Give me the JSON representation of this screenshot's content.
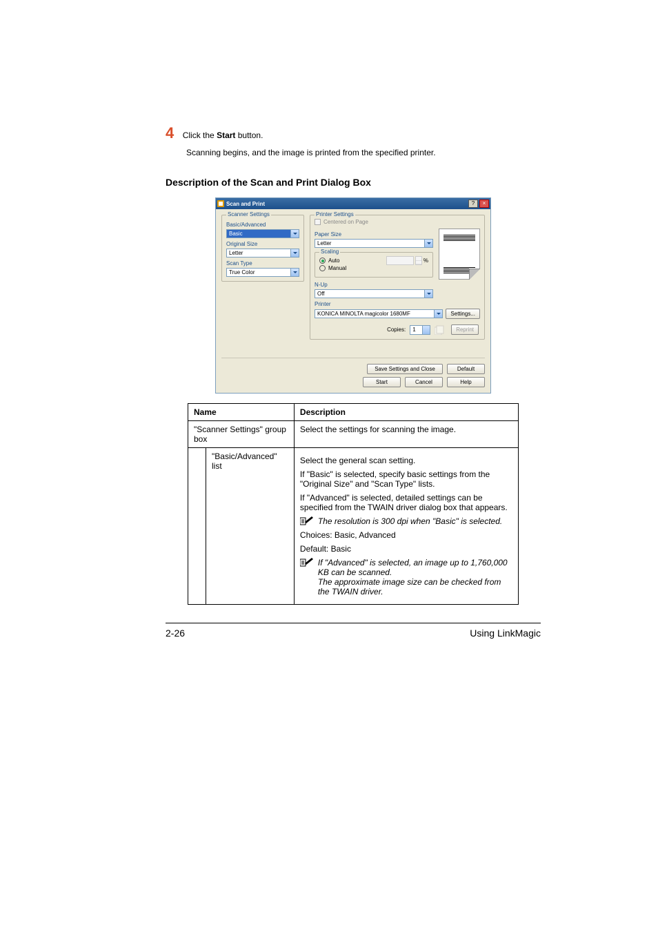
{
  "step": {
    "num": "4",
    "line": "Click the ",
    "bold": "Start",
    "line_after": " button.",
    "sub": "Scanning begins, and the image is printed from the specified printer."
  },
  "heading": "Description of the Scan and Print Dialog Box",
  "dialog": {
    "title": "Scan and Print",
    "help": "?",
    "close": "×",
    "scanner": {
      "legend": "Scanner Settings",
      "basic_label": "Basic/Advanced",
      "basic_value": "Basic",
      "orig_label": "Original Size",
      "orig_value": "Letter",
      "scan_label": "Scan Type",
      "scan_value": "True Color"
    },
    "printer": {
      "legend": "Printer Settings",
      "centered": "Centered on Page",
      "paper_label": "Paper Size",
      "paper_value": "Letter",
      "scaling_legend": "Scaling",
      "auto": "Auto",
      "manual": "Manual",
      "pct": "%",
      "nup_label": "N-Up",
      "nup_value": "Off",
      "printer_label": "Printer",
      "printer_value": "KONICA MINOLTA magicolor 1680MF",
      "settings_btn": "Settings...",
      "copies_label": "Copies:",
      "copies_value": "1",
      "reprint_btn": "Reprint"
    },
    "footer": {
      "save": "Save Settings and Close",
      "default": "Default",
      "start": "Start",
      "cancel": "Cancel",
      "help": "Help"
    }
  },
  "table": {
    "h1": "Name",
    "h2": "Description",
    "r1_name": "\"Scanner Settings\" group box",
    "r1_desc": "Select the settings for scanning the image.",
    "r2_name": "\"Basic/Advanced\" list",
    "r2_p1": "Select the general scan setting.",
    "r2_p2": "If \"Basic\" is selected, specify basic settings from the \"Original Size\" and \"Scan Type\" lists.",
    "r2_p3": "If \"Advanced\" is selected, detailed settings can be specified from the TWAIN driver dialog box that appears.",
    "r2_note1": "The resolution is 300 dpi when \"Basic\" is selected.",
    "r2_p4": "Choices: Basic, Advanced",
    "r2_p5": "Default: Basic",
    "r2_note2a": "If \"Advanced\" is selected, an image up to 1,760,000 KB can be scanned.",
    "r2_note2b": "The approximate image size can be checked from the TWAIN driver."
  },
  "footer": {
    "page": "2-26",
    "title": "Using LinkMagic"
  }
}
